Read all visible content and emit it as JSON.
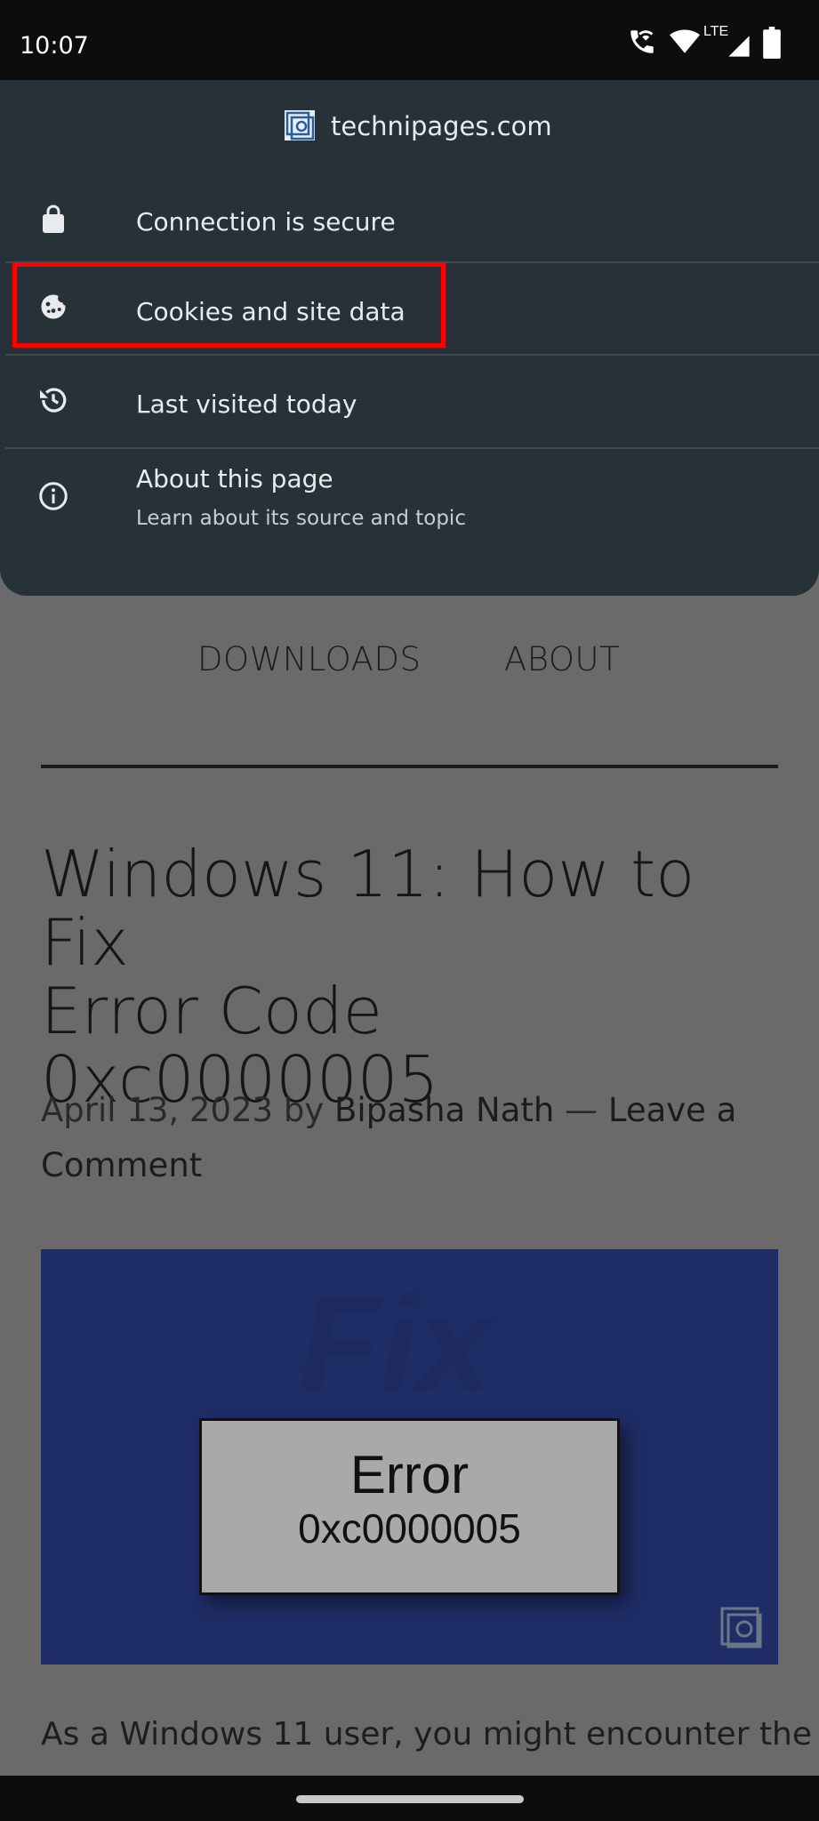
{
  "status_bar": {
    "time": "10:07",
    "network_label": "LTE",
    "icons": [
      "wifi-calling-icon",
      "wifi-icon",
      "lte-signal-icon",
      "battery-icon"
    ]
  },
  "site_info": {
    "domain": "technipages.com",
    "items": [
      {
        "label": "Connection is secure",
        "icon": "lock-icon"
      },
      {
        "label": "Cookies and site data",
        "icon": "cookie-icon"
      },
      {
        "label": "Last visited today",
        "icon": "history-icon"
      },
      {
        "label": "About this page",
        "sublabel": "Learn about its source and topic",
        "icon": "info-icon"
      }
    ]
  },
  "page": {
    "nav": [
      "DOWNLOADS",
      "ABOUT"
    ],
    "title_lines": [
      "Windows 11: How to Fix",
      "Error Code",
      "0xc0000005"
    ],
    "byline": {
      "date": "April 13, 2023",
      "by": "by",
      "author": "Bipasha Nath",
      "separator": "—",
      "comment_link": "Leave a Comment"
    },
    "hero": {
      "watermark": "Fix",
      "error_title": "Error",
      "error_code": "0xc0000005"
    },
    "body_text": "As a Windows 11 user, you might encounter the"
  },
  "colors": {
    "sheet_bg": "#263238",
    "highlight": "#ff0000",
    "hero_bg": "#1f2d67"
  }
}
